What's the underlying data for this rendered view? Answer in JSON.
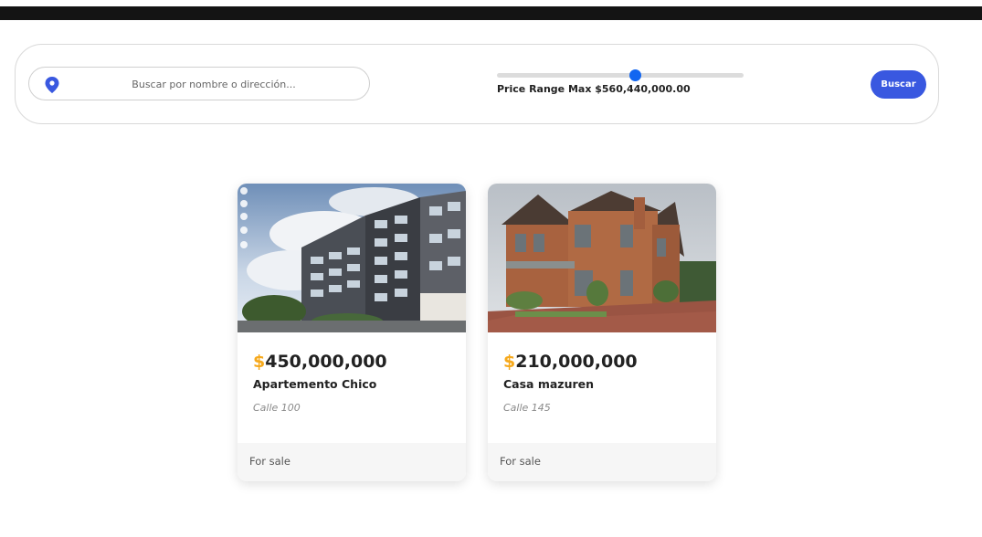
{
  "search": {
    "placeholder": "Buscar por nombre o dirección...",
    "price_label": "Price Range Max $560,440,000.00",
    "price_fraction": 0.56,
    "button_label": "Buscar"
  },
  "colors": {
    "accent_blue": "#3958e0",
    "slider_blue": "#1266f1",
    "price_currency": "#f6a91c"
  },
  "listings": [
    {
      "currency": "$",
      "price": "450,000,000",
      "title": "Apartemento Chico",
      "address": "Calle 100",
      "status": "For sale",
      "image_icon": "building-photo"
    },
    {
      "currency": "$",
      "price": "210,000,000",
      "title": "Casa mazuren",
      "address": "Calle 145",
      "status": "For sale",
      "image_icon": "house-photo"
    }
  ]
}
